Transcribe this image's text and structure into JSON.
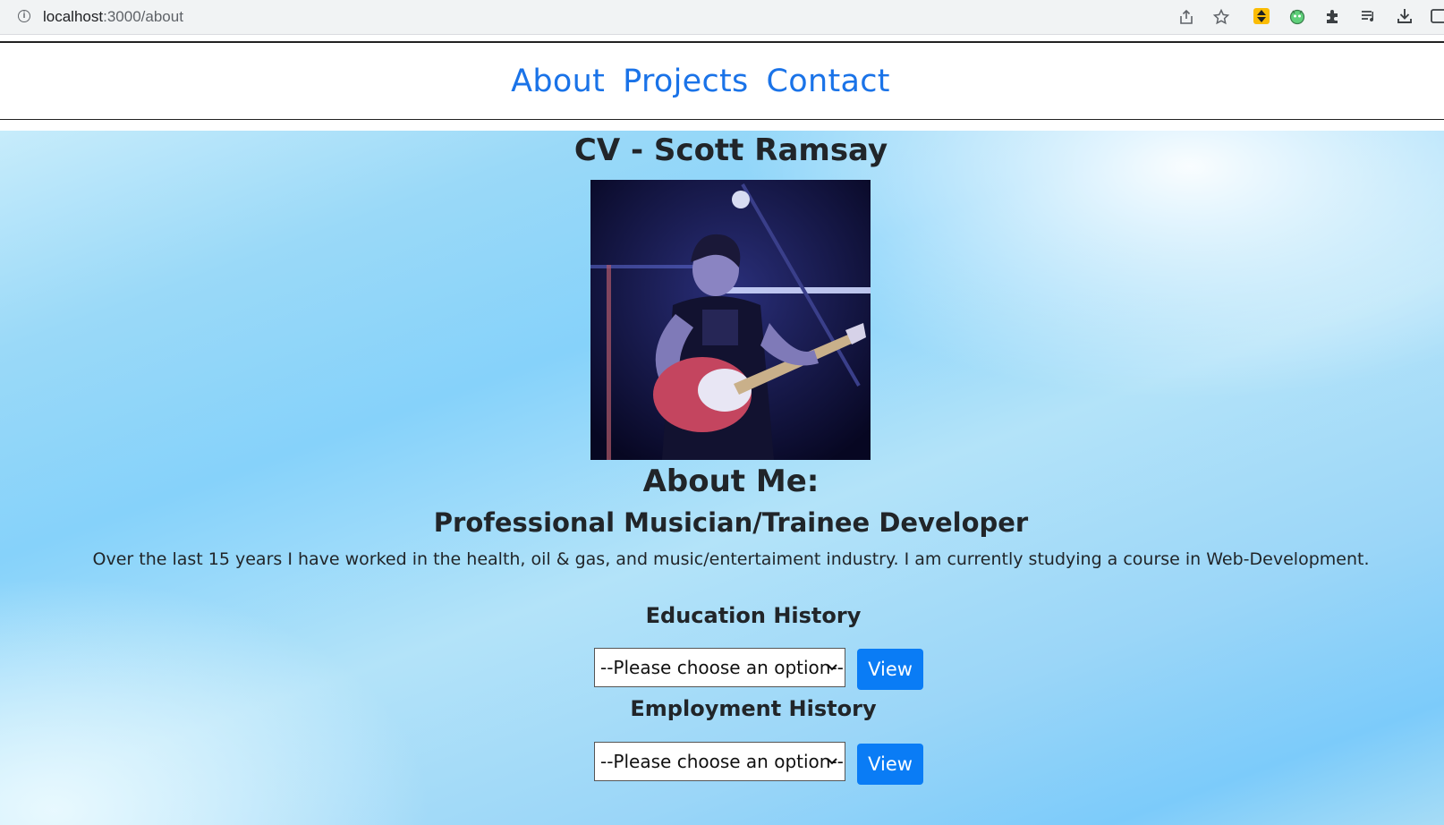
{
  "browser": {
    "url_host": "localhost",
    "url_path": ":3000/about",
    "icons": [
      "info-icon",
      "share-icon",
      "star-icon",
      "extension-a-icon",
      "extension-b-icon",
      "extensions-puzzle-icon",
      "reading-list-icon",
      "download-icon",
      "side-panel-icon"
    ]
  },
  "nav": {
    "links": [
      "About",
      "Projects",
      "Contact"
    ],
    "link_color": "#1a73e8"
  },
  "main": {
    "title": "CV - Scott Ramsay",
    "about_heading": "About Me:",
    "subtitle": "Professional Musician/Trainee Developer",
    "bio": "Over the last 15 years I have worked in the health, oil & gas, and music/entertaiment industry. I am currently studying a course in Web-Development."
  },
  "education": {
    "title": "Education History",
    "select_value": "--Please choose an option--",
    "button_label": "View"
  },
  "employment": {
    "title": "Employment History",
    "select_value": "--Please choose an option--",
    "button_label": "View"
  },
  "colors": {
    "accent": "#0a7cf5",
    "text": "#212529"
  }
}
